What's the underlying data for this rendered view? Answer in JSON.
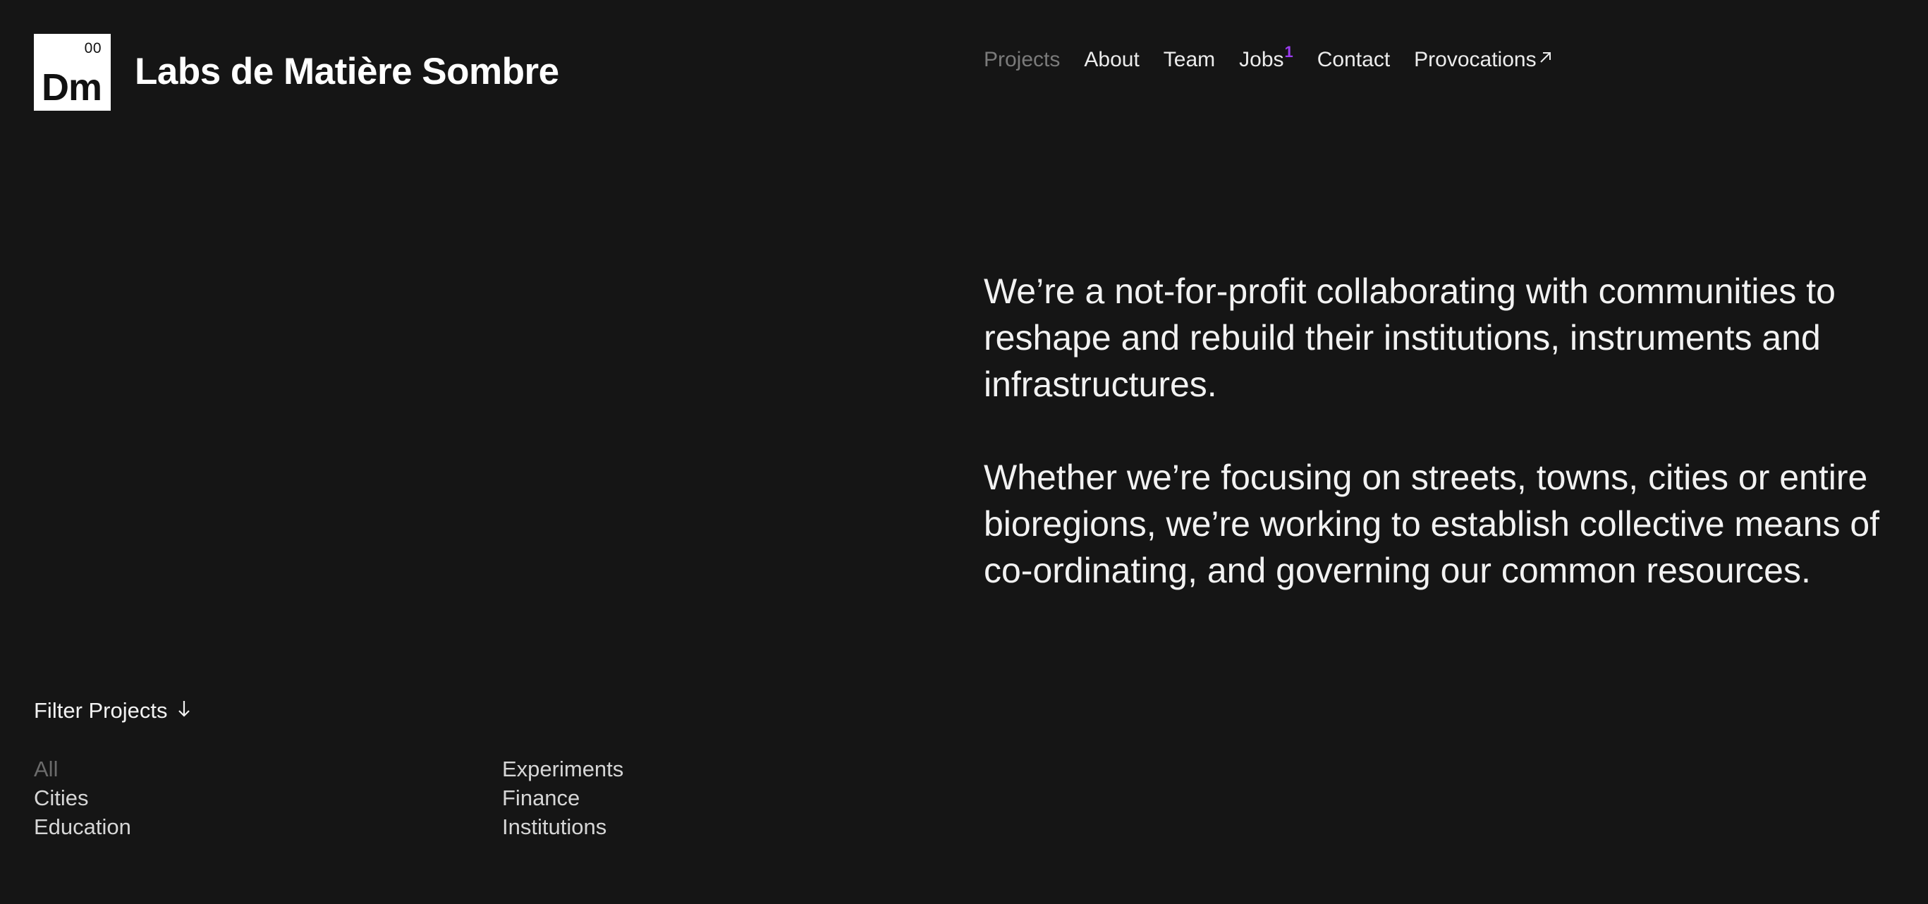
{
  "logo": {
    "number": "00",
    "symbol": "Dm"
  },
  "brand": {
    "name": "Labs de Matière Sombre"
  },
  "nav": {
    "items": [
      {
        "label": "Projects",
        "current": true
      },
      {
        "label": "About"
      },
      {
        "label": "Team"
      },
      {
        "label": "Jobs",
        "badge": "1"
      },
      {
        "label": "Contact"
      },
      {
        "label": "Provocations",
        "icon": "arrow-up-right-icon"
      }
    ]
  },
  "intro": {
    "paragraphs": [
      "We’re a not-for-profit collaborating with communities to reshape and rebuild their institutions, instruments and infrastructures.",
      "Whether we’re focusing on streets, towns, cities or entire bioregions, we’re working to establish collective means of co-ordinating, and governing our common resources."
    ]
  },
  "filter": {
    "label": "Filter Projects",
    "icon": "arrow-down-icon",
    "columns": [
      [
        "All",
        "Cities",
        "Education"
      ],
      [
        "Experiments",
        "Finance",
        "Institutions"
      ]
    ],
    "active": "All"
  },
  "colors": {
    "background": "#151515",
    "text": "#ececec",
    "muted": "#7a7a7a",
    "badge": "#9b3cf0"
  }
}
